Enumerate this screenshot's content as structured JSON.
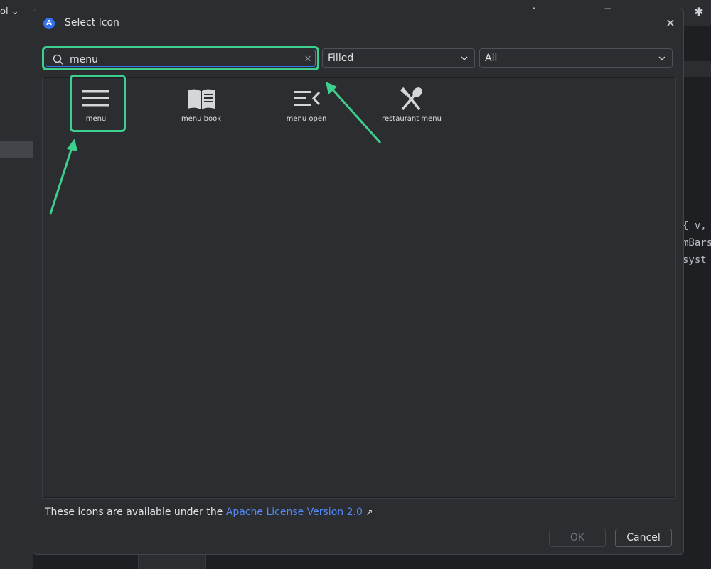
{
  "ide": {
    "project_label": "ol",
    "code_lines": [
      "{ v,",
      "mBars",
      " syst"
    ]
  },
  "dialog": {
    "title": "Select Icon",
    "search": {
      "value": "menu",
      "placeholder": ""
    },
    "style_select": {
      "selected": "Filled"
    },
    "category_select": {
      "selected": "All"
    },
    "icons": [
      {
        "label": "menu",
        "icon": "menu-icon",
        "selected": true
      },
      {
        "label": "menu book",
        "icon": "menu-book-icon",
        "selected": false
      },
      {
        "label": "menu open",
        "icon": "menu-open-icon",
        "selected": false
      },
      {
        "label": "restaurant menu",
        "icon": "restaurant-menu-icon",
        "selected": false
      }
    ],
    "license": {
      "prefix": "These icons are available under the ",
      "link_text": "Apache License Version 2.0",
      "ext_glyph": "↗"
    },
    "buttons": {
      "ok": "OK",
      "cancel": "Cancel"
    }
  },
  "colors": {
    "highlight": "#3ecf8e",
    "accent": "#3574f0",
    "link": "#548af7",
    "dialog_bg": "#2b2d30"
  }
}
